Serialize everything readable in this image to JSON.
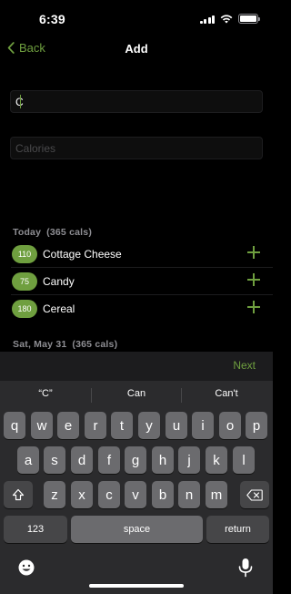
{
  "status_bar": {
    "time": "6:39"
  },
  "nav": {
    "back_label": "Back",
    "title": "Add"
  },
  "form": {
    "name_value": "C",
    "name_placeholder": "",
    "calories_value": "",
    "calories_placeholder": "Calories"
  },
  "sections": [
    {
      "title": "Today",
      "total": "(365 cals)",
      "items": [
        {
          "calories": "110",
          "name": "Cottage Cheese"
        },
        {
          "calories": "75",
          "name": "Candy"
        },
        {
          "calories": "180",
          "name": "Cereal"
        }
      ]
    },
    {
      "title": "Sat, May 31",
      "total": "(365 cals)",
      "items": []
    }
  ],
  "accessory": {
    "next_label": "Next"
  },
  "keyboard": {
    "suggestions": [
      "“C”",
      "Can",
      "Can't"
    ],
    "row1": [
      "q",
      "w",
      "e",
      "r",
      "t",
      "y",
      "u",
      "i",
      "o",
      "p"
    ],
    "row2": [
      "a",
      "s",
      "d",
      "f",
      "g",
      "h",
      "j",
      "k",
      "l"
    ],
    "row3": [
      "z",
      "x",
      "c",
      "v",
      "b",
      "n",
      "m"
    ],
    "numbers_label": "123",
    "space_label": "space",
    "return_label": "return"
  },
  "colors": {
    "accent": "#6f9f3f",
    "background": "#000000",
    "keyboard_bg": "#2b2b2d",
    "key_bg": "#6b6b6e"
  }
}
